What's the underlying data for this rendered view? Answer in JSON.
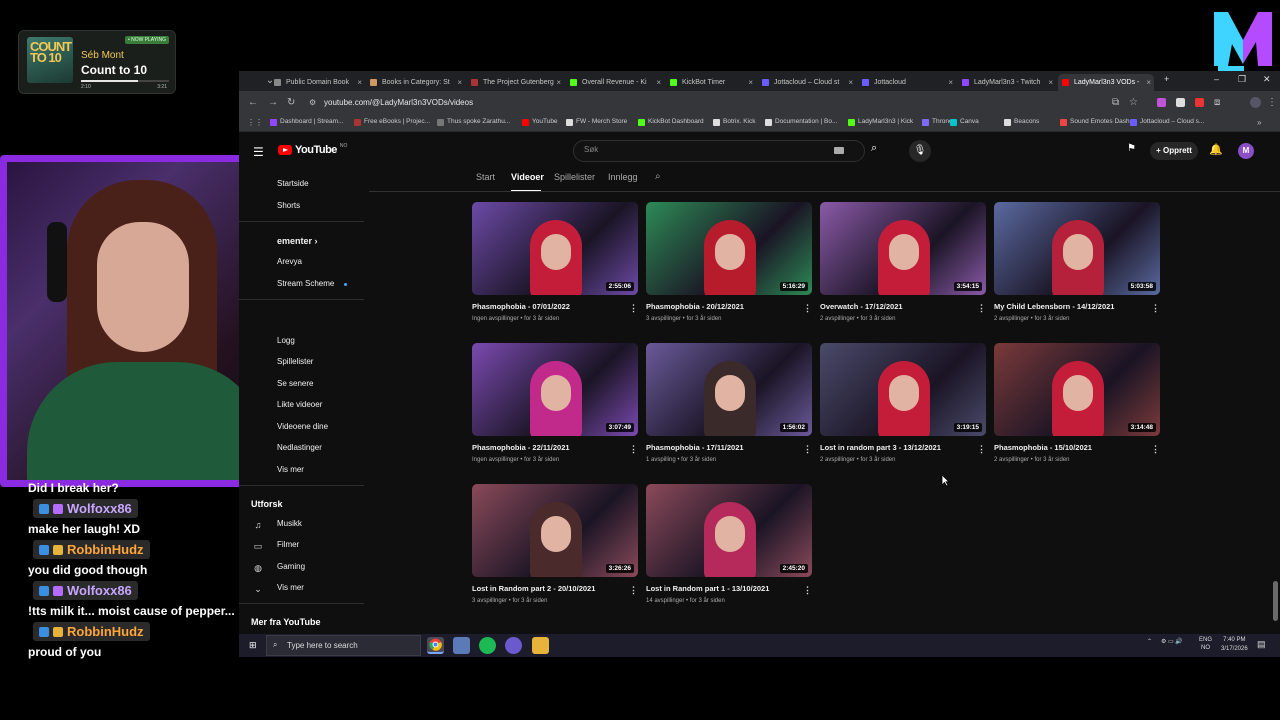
{
  "now_playing": {
    "art_text": "COUNT TO 10",
    "badge": "• NOW PLAYING",
    "artist": "Séb Mont",
    "title": "Count to 10",
    "elapsed": "2:10",
    "duration": "3:21",
    "progress": 0.65
  },
  "chat": [
    {
      "type": "message",
      "text": "Did I break her?"
    },
    {
      "type": "user",
      "name": "Wolfoxx86",
      "color": "#c7a6ff"
    },
    {
      "type": "message",
      "text": "make her laugh! XD"
    },
    {
      "type": "user",
      "name": "RobbinHudz",
      "color": "#ffa53a"
    },
    {
      "type": "message",
      "text": "you did good though"
    },
    {
      "type": "user",
      "name": "Wolfoxx86",
      "color": "#c7a6ff"
    },
    {
      "type": "message",
      "text": "!tts milk it... moist cause of pepper..."
    },
    {
      "type": "user",
      "name": "RobbinHudz",
      "color": "#ffa53a"
    },
    {
      "type": "message",
      "text": "proud of you"
    }
  ],
  "browser": {
    "tabs": [
      {
        "label": "Public Domain Book",
        "color": "#888"
      },
      {
        "label": "Books in Category: St",
        "color": "#c96"
      },
      {
        "label": "The Project Gutenberg",
        "color": "#a33"
      },
      {
        "label": "Overall Revenue - Ki",
        "color": "#53fc18"
      },
      {
        "label": "KickBot Timer",
        "color": "#53fc18"
      },
      {
        "label": "Jottacloud – Cloud st",
        "color": "#6b5cff"
      },
      {
        "label": "Jottacloud",
        "color": "#6b5cff"
      },
      {
        "label": "LadyMarl3n3 - Twitch",
        "color": "#9146ff"
      },
      {
        "label": "LadyMarl3n3 VODs -",
        "color": "#ff0000",
        "active": true
      }
    ],
    "url": "youtube.com/@LadyMarl3n3VODs/videos",
    "bookmarks": [
      {
        "label": "Dashboard | Stream...",
        "color": "#9146ff"
      },
      {
        "label": "Free eBooks | Projec...",
        "color": "#a33"
      },
      {
        "label": "Thus spoke Zarathu...",
        "color": "#777"
      },
      {
        "label": "YouTube",
        "color": "#ff0000"
      },
      {
        "label": "FW - Merch Store",
        "color": "#ddd"
      },
      {
        "label": "KickBot Dashboard",
        "color": "#53fc18"
      },
      {
        "label": "Botrix. Kick",
        "color": "#ddd"
      },
      {
        "label": "Documentation | Bo...",
        "color": "#ddd"
      },
      {
        "label": "LadyMarl3n3 | Kick",
        "color": "#53fc18"
      },
      {
        "label": "Throne",
        "color": "#7d6bff"
      },
      {
        "label": "Canva",
        "color": "#00c4cc"
      },
      {
        "label": "Beacons",
        "color": "#ddd"
      },
      {
        "label": "Sound Emotes Dash...",
        "color": "#e44"
      },
      {
        "label": "Jottacloud – Cloud s...",
        "color": "#6b5cff"
      }
    ]
  },
  "youtube": {
    "logo": "YouTube",
    "country": "NO",
    "search_placeholder": "Søk",
    "create_label": "Opprett",
    "avatar_letter": "M",
    "sidebar": {
      "items_top": [
        "Startside",
        "Shorts"
      ],
      "subscriptions_header": "ementer",
      "subscriptions": [
        "Arevya",
        "Stream Scheme"
      ],
      "you_items": [
        "Logg",
        "Spillelister",
        "Se senere",
        "Likte videoer",
        "Videoene dine",
        "Nedlastinger",
        "Vis mer"
      ],
      "explore_header": "Utforsk",
      "explore_items": [
        "Musikk",
        "Filmer",
        "Gaming",
        "Vis mer"
      ],
      "more_header": "Mer fra YouTube"
    },
    "channel_tabs": [
      {
        "label": "Start"
      },
      {
        "label": "Videoer",
        "active": true
      },
      {
        "label": "Spillelister"
      },
      {
        "label": "Innlegg"
      }
    ],
    "videos": [
      {
        "title": "Phasmophobia - 07/01/2022",
        "meta": "Ingen avspillinger • for 3 år siden",
        "duration": "2:55:06",
        "bg": "#6c4aa6",
        "hair": "#c41d3a"
      },
      {
        "title": "Phasmophobia - 20/12/2021",
        "meta": "3 avspillinger • for 3 år siden",
        "duration": "5:16:29",
        "bg": "#2d8a56",
        "hair": "#b71c2c"
      },
      {
        "title": "Overwatch - 17/12/2021",
        "meta": "2 avspillinger • for 3 år siden",
        "duration": "3:54:15",
        "bg": "#8a5aa8",
        "hair": "#c41d3a"
      },
      {
        "title": "My Child Lebensborn - 14/12/2021",
        "meta": "2 avspillinger • for 3 år siden",
        "duration": "5:03:58",
        "bg": "#5a6aa0",
        "hair": "#b5203a"
      },
      {
        "title": "Phasmophobia - 22/11/2021",
        "meta": "Ingen avspillinger • for 3 år siden",
        "duration": "3:07:49",
        "bg": "#7a4ab0",
        "hair": "#c12a8a"
      },
      {
        "title": "Phasmophobia - 17/11/2021",
        "meta": "1 avspilling • for 3 år siden",
        "duration": "1:56:02",
        "bg": "#6a5a9a",
        "hair": "#3a2a2a"
      },
      {
        "title": "Lost in random part 3 - 13/12/2021",
        "meta": "2 avspillinger • for 3 år siden",
        "duration": "3:19:15",
        "bg": "#4a4a6a",
        "hair": "#c41d3a"
      },
      {
        "title": "Phasmophobia - 15/10/2021",
        "meta": "2 avspillinger • for 3 år siden",
        "duration": "3:14:48",
        "bg": "#7a3a3a",
        "hair": "#c41d3a"
      },
      {
        "title": "Lost in Random part 2 - 20/10/2021",
        "meta": "3 avspillinger • for 3 år siden",
        "duration": "3:26:26",
        "bg": "#8a4a5a",
        "hair": "#4a2a2a"
      },
      {
        "title": "Lost in Random part 1 - 13/10/2021",
        "meta": "14 avspillinger • for 3 år siden",
        "duration": "2:45:20",
        "bg": "#8a4a5a",
        "hair": "#b52a5a"
      }
    ]
  },
  "taskbar": {
    "search_placeholder": "Type here to search",
    "lang_1": "ENG",
    "lang_2": "NO",
    "time": "7:40 PM",
    "date": "3/17/2026"
  },
  "colors": {
    "webcam_border": "#8a2be2",
    "youtube_red": "#ff0000",
    "logo_cyan": "#3fd4ff",
    "logo_purple": "#b44bff"
  }
}
